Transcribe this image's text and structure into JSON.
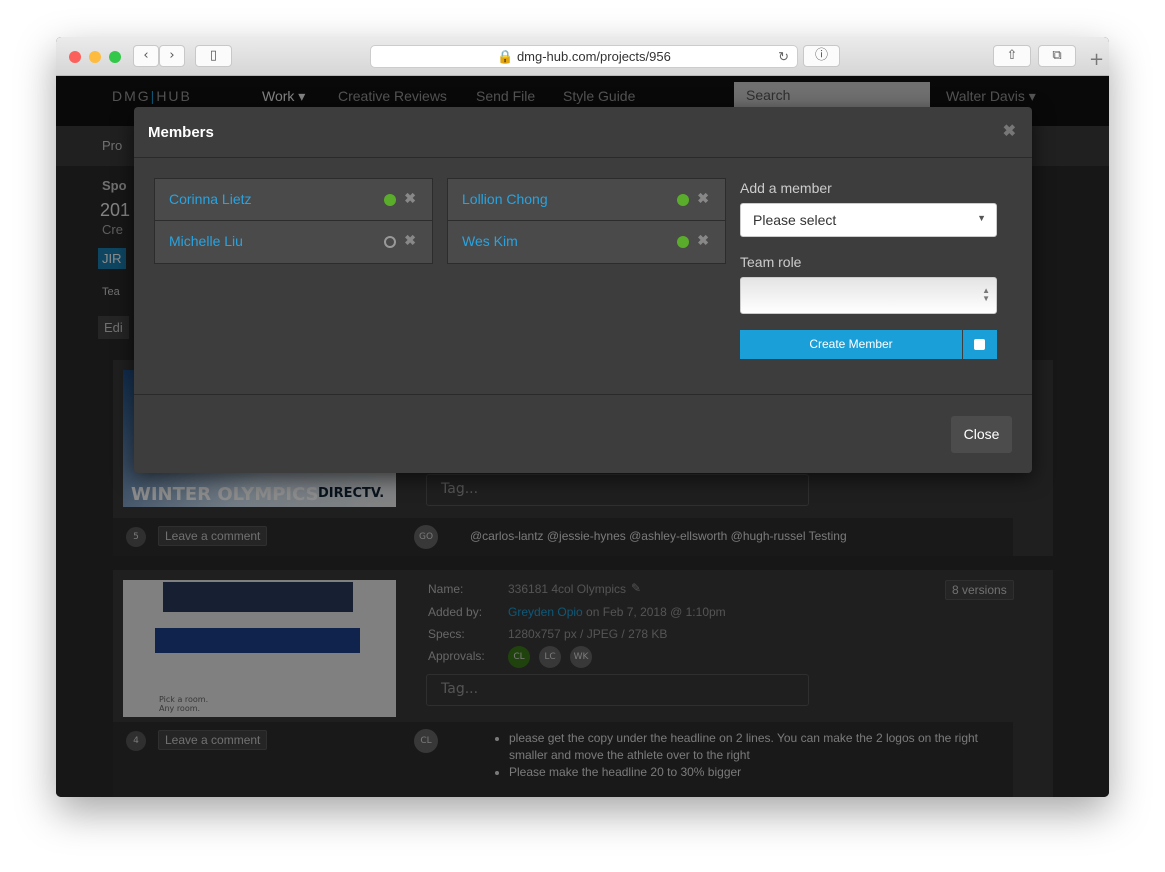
{
  "browser": {
    "url": "dmg-hub.com/projects/956"
  },
  "nav": {
    "logo_left": "DMG",
    "logo_right": "HUB",
    "items": [
      "Work ▾",
      "Creative Reviews",
      "Send File",
      "Style Guide"
    ],
    "search_placeholder": "Search",
    "user": "Walter Davis ▾"
  },
  "background": {
    "fragments": [
      "Pro",
      "Spo",
      "201",
      "Cre",
      "JIR",
      "Tea",
      "Edi"
    ],
    "card1": {
      "comment_count": "5",
      "leave_comment": "Leave a comment",
      "tag_placeholder": "Tag...",
      "commenter": "GO",
      "comment": "@carlos-lantz @jessie-hynes @ashley-ellsworth @hugh-russel Testing",
      "thumb_text": "WINTER OLYMPICS",
      "thumb_brand": "DIRECTV."
    },
    "card2": {
      "name_label": "Name:",
      "name": "336181 4col Olympics",
      "added_label": "Added by:",
      "added_by": "Greyden Opio",
      "added_on": " on Feb 7, 2018 @ 1:10pm",
      "specs_label": "Specs:",
      "specs": "1280x757 px / JPEG / 278 KB",
      "approvals_label": "Approvals:",
      "approvals": [
        "CL",
        "LC",
        "WK"
      ],
      "versions": "8 versions",
      "tag_placeholder": "Tag...",
      "comment_count": "4",
      "leave_comment": "Leave a comment",
      "commenter": "CL",
      "comments": [
        "please get the copy under the headline on 2 lines. You can make the 2 logos on the right smaller and move the athlete over to the right",
        "Please make the headline 20 to 30% bigger"
      ]
    }
  },
  "modal": {
    "title": "Members",
    "members": [
      {
        "name": "Corinna Lietz",
        "status": "active"
      },
      {
        "name": "Michelle Liu",
        "status": "inactive"
      },
      {
        "name": "Lollion Chong",
        "status": "active"
      },
      {
        "name": "Wes Kim",
        "status": "active"
      }
    ],
    "add_member_label": "Add a member",
    "add_member_value": "Please select",
    "team_role_label": "Team role",
    "team_role_value": "",
    "create_button": "Create Member",
    "close_button": "Close"
  },
  "colors": {
    "accent": "#1a9fd9",
    "active": "#5aad2a",
    "link": "#29a3e0"
  }
}
